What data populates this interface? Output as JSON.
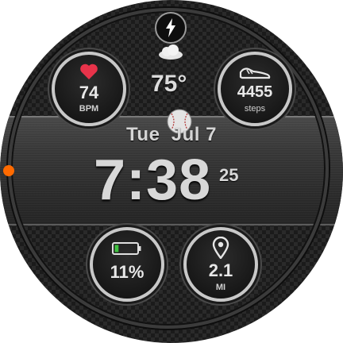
{
  "watch": {
    "date": "Tue  Jul 7",
    "time": "7:38",
    "seconds": "25"
  },
  "weather": {
    "temperature": "75°",
    "icon": "cloud-icon"
  },
  "charging": {
    "icon": "lightning-bolt-icon"
  },
  "heart_rate": {
    "icon": "heart-icon",
    "value": "74",
    "unit": "BPM"
  },
  "steps": {
    "icon": "shoe-icon",
    "value": "4455",
    "unit": "steps"
  },
  "battery": {
    "icon": "battery-icon",
    "value": "11%",
    "level": 0.11
  },
  "distance": {
    "icon": "location-pin-icon",
    "value": "2.1",
    "unit": "MI"
  },
  "colors": {
    "heart": "#e8334a",
    "battery_fill": "#3fc23f",
    "indicator_dot": "#ff6a00"
  }
}
